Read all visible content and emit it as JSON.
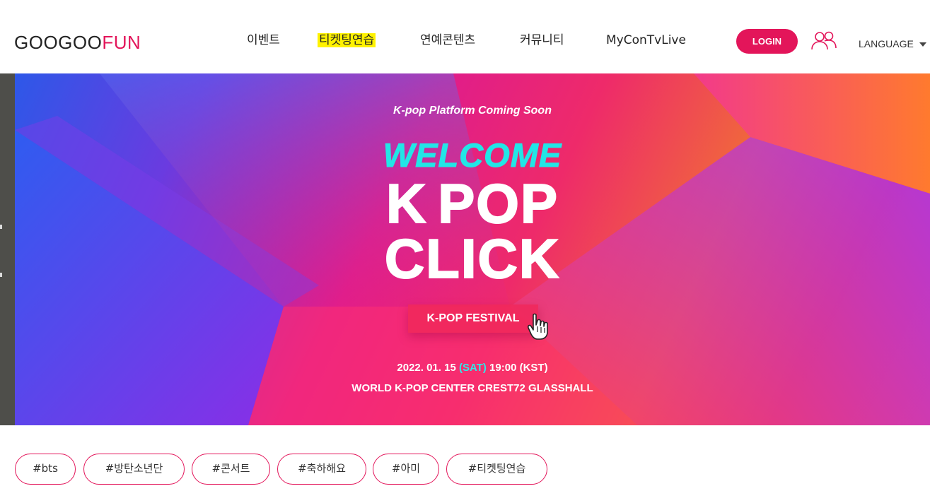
{
  "header": {
    "logo_main": "GOOGOO",
    "logo_accent": "FUN",
    "nav": [
      {
        "label": "이벤트"
      },
      {
        "label": "티켓팅연습"
      },
      {
        "label": "연예콘텐츠"
      },
      {
        "label": "커뮤니티"
      },
      {
        "label": "MyConTvLive"
      }
    ],
    "login_label": "LOGIN",
    "user_icon": "users-icon",
    "language_label": "LANGUAGE",
    "accent_color": "#e3155a"
  },
  "banner": {
    "subtitle": "K-pop Platform Coming Soon",
    "welcome": "WELCOME",
    "title_line1": "K POP",
    "title_line2": "CLICK",
    "button_label": "K-POP FESTIVAL",
    "date_prefix": "2022. 01. 15 ",
    "date_day": "(SAT)",
    "date_suffix": " 19:00 (KST)",
    "venue": "WORLD K-POP CENTER CREST72 GLASSHALL"
  },
  "tags": [
    {
      "label": "#bts"
    },
    {
      "label": "#방탄소년단"
    },
    {
      "label": "#콘서트"
    },
    {
      "label": "#축하해요"
    },
    {
      "label": "#아미"
    },
    {
      "label": "#티켓팅연습"
    }
  ]
}
